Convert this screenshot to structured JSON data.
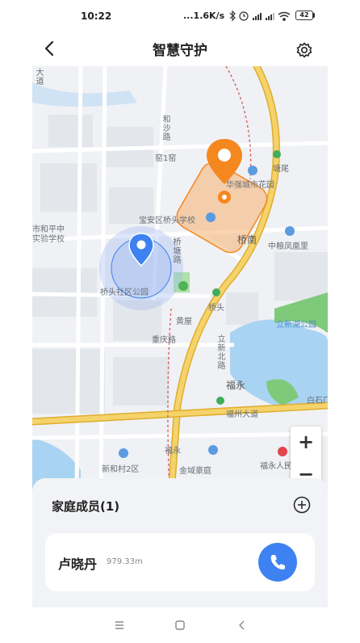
{
  "status": {
    "time": "10:22",
    "network": "...1.6K/s",
    "battery": "42"
  },
  "header": {
    "title": "智慧守护",
    "back_icon": "chevron-left-icon",
    "settings_icon": "gear-icon"
  },
  "map": {
    "labels": {
      "da_dao_v": "大道",
      "heshalu": "和沙路",
      "ao1": "窑1窑",
      "tangwei": "塘尾",
      "huaqiang": "华强城市花园",
      "shiheping": "市和平中",
      "shiyan": "实验学校",
      "baoan": "宝安区桥头学校",
      "qiaonan": "桥南",
      "zhongliang": "中粮凤凰里",
      "qiaotang": "桥塘路",
      "qiaotou_park": "桥头社区公园",
      "qiaotou": "桥头",
      "huangwu": "黄屋",
      "chongqing": "重庆路",
      "lixinhu": "立新湖公园",
      "lixinbeilu": "立新北路",
      "fuyong": "福永",
      "baishi": "白石厂",
      "fuzhou": "福州大道",
      "fuyong2": "福永",
      "xinhe2": "新和村2区",
      "jinyu": "金域豪庭",
      "fuyong_hosp": "福永人民医院"
    },
    "zoom_in": "+",
    "zoom_out": "−"
  },
  "panel": {
    "members_title": "家庭成员(1)",
    "add_icon": "plus-circle-icon",
    "members": [
      {
        "name": "卢晓丹",
        "distance": "979.33m",
        "call_icon": "phone-icon"
      }
    ]
  },
  "colors": {
    "accent_blue": "#3d82f0",
    "fence_orange": "#f5871f",
    "road_yellow": "#f2c94c",
    "water": "#a9d3f2",
    "park": "#6ec06a"
  }
}
